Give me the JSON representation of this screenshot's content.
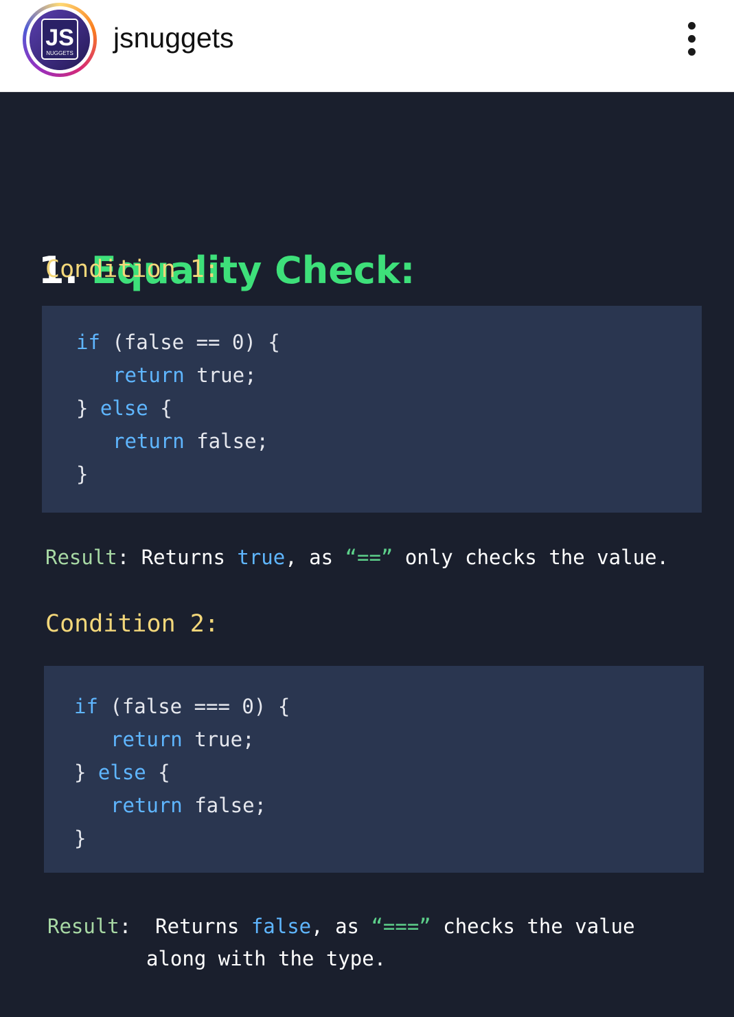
{
  "header": {
    "avatar": {
      "logo_text": "JS",
      "logo_subtext": "NUGGETS"
    },
    "username": "jsnuggets",
    "more_icon": "more-vertical-icon"
  },
  "post": {
    "title_number": "1.",
    "title_text": "Equality Check:",
    "conditions": [
      {
        "label": "Condition 1:",
        "code": {
          "line1": {
            "kw": "if",
            "rest": " (false == 0) {"
          },
          "line2": {
            "kw": "return",
            "rest": " true;"
          },
          "line3": {
            "pre": "} ",
            "kw": "else",
            "rest": " {"
          },
          "line4": {
            "kw": "return",
            "rest": " false;"
          },
          "line5": {
            "rest": "}"
          }
        },
        "result": {
          "label": "Result",
          "colon": ": ",
          "t1": "Returns ",
          "value": "true",
          "t2": ", as ",
          "operator": "“==”",
          "t3": " only checks the value.",
          "t4": ""
        }
      },
      {
        "label": "Condition 2:",
        "code": {
          "line1": {
            "kw": "if",
            "rest": " (false === 0) {"
          },
          "line2": {
            "kw": "return",
            "rest": " true;"
          },
          "line3": {
            "pre": "} ",
            "kw": "else",
            "rest": " {"
          },
          "line4": {
            "kw": "return",
            "rest": " false;"
          },
          "line5": {
            "rest": "}"
          }
        },
        "result": {
          "label": "Result",
          "colon": ":  ",
          "t1": "Returns ",
          "value": "false",
          "t2": ", as ",
          "operator": "“===”",
          "t3": " checks the value",
          "t4": "along with the type."
        }
      }
    ]
  },
  "colors": {
    "background": "#1a1f2d",
    "code_box": "#2a3650",
    "title_accent": "#3ee07a",
    "condition_label": "#f3d77a",
    "keyword": "#5fb6ff",
    "result_label": "#a8d9a4",
    "operator": "#5dd08a"
  }
}
